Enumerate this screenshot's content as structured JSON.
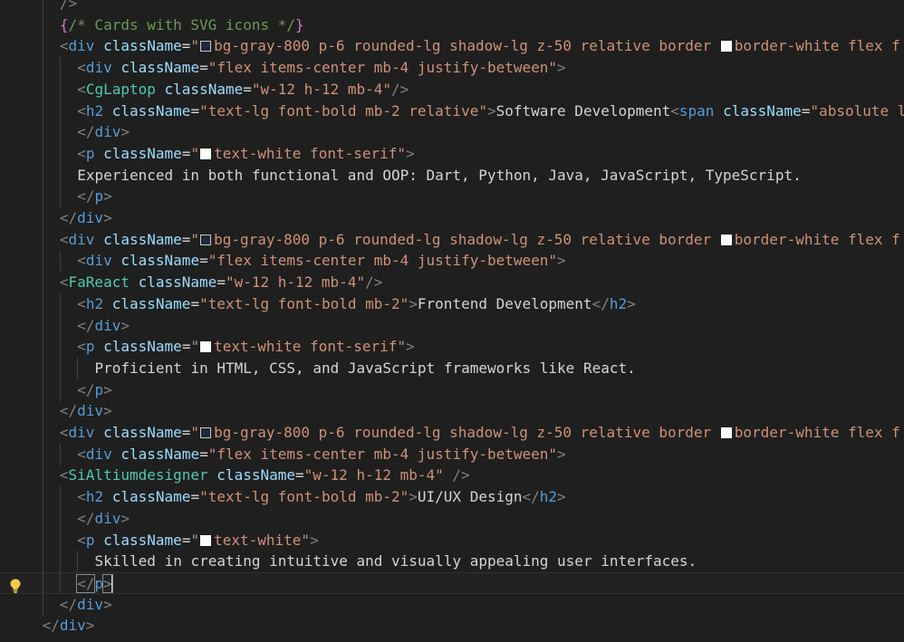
{
  "editor": {
    "colors": {
      "tag_bracket": "#808080",
      "tag_name": "#569cd6",
      "component": "#4ec9b0",
      "attribute": "#9cdcfe",
      "string": "#ce9178",
      "text": "#d4d4d4",
      "brace": "#da70d6",
      "comment": "#6a9955"
    },
    "lightbulb_icon": "lightbulb-icon",
    "lines": [
      {
        "indent": 3,
        "tokens": [
          {
            "c": "tag",
            "v": "/>"
          }
        ]
      },
      {
        "indent": 3,
        "tokens": [
          {
            "c": "brace",
            "v": "{"
          },
          {
            "c": "comment",
            "v": "/* Cards with SVG icons */"
          },
          {
            "c": "brace",
            "v": "}"
          }
        ]
      },
      {
        "indent": 3,
        "tokens": [
          {
            "c": "tag",
            "v": "<"
          },
          {
            "c": "name",
            "v": "div"
          },
          {
            "c": "text",
            "v": " "
          },
          {
            "c": "attr",
            "v": "className"
          },
          {
            "c": "eq",
            "v": "="
          },
          {
            "c": "str",
            "v": "\""
          },
          {
            "c": "swatch",
            "v": "gray"
          },
          {
            "c": "str",
            "v": "bg-gray-800 p-6 rounded-lg shadow-lg z-50 relative border "
          },
          {
            "c": "swatch",
            "v": "white"
          },
          {
            "c": "str",
            "v": "border-white flex f"
          }
        ]
      },
      {
        "indent": 4,
        "tokens": [
          {
            "c": "tag",
            "v": "<"
          },
          {
            "c": "name",
            "v": "div"
          },
          {
            "c": "text",
            "v": " "
          },
          {
            "c": "attr",
            "v": "className"
          },
          {
            "c": "eq",
            "v": "="
          },
          {
            "c": "str",
            "v": "\"flex items-center mb-4 justify-between\""
          },
          {
            "c": "tag",
            "v": ">"
          }
        ]
      },
      {
        "indent": 4,
        "tokens": [
          {
            "c": "tag",
            "v": "<"
          },
          {
            "c": "comp",
            "v": "CgLaptop"
          },
          {
            "c": "text",
            "v": " "
          },
          {
            "c": "attr",
            "v": "className"
          },
          {
            "c": "eq",
            "v": "="
          },
          {
            "c": "str",
            "v": "\"w-12 h-12 mb-4\""
          },
          {
            "c": "tag",
            "v": "/>"
          }
        ]
      },
      {
        "indent": 4,
        "tokens": [
          {
            "c": "tag",
            "v": "<"
          },
          {
            "c": "name",
            "v": "h2"
          },
          {
            "c": "text",
            "v": " "
          },
          {
            "c": "attr",
            "v": "className"
          },
          {
            "c": "eq",
            "v": "="
          },
          {
            "c": "str",
            "v": "\"text-lg font-bold mb-2 relative\""
          },
          {
            "c": "tag",
            "v": ">"
          },
          {
            "c": "text",
            "v": "Software Development"
          },
          {
            "c": "tag",
            "v": "<"
          },
          {
            "c": "name",
            "v": "span"
          },
          {
            "c": "text",
            "v": " "
          },
          {
            "c": "attr",
            "v": "className"
          },
          {
            "c": "eq",
            "v": "="
          },
          {
            "c": "str",
            "v": "\"absolute l"
          }
        ]
      },
      {
        "indent": 4,
        "tokens": [
          {
            "c": "tag",
            "v": "</"
          },
          {
            "c": "name",
            "v": "div"
          },
          {
            "c": "tag",
            "v": ">"
          }
        ]
      },
      {
        "indent": 4,
        "tokens": [
          {
            "c": "tag",
            "v": "<"
          },
          {
            "c": "name",
            "v": "p"
          },
          {
            "c": "text",
            "v": " "
          },
          {
            "c": "attr",
            "v": "className"
          },
          {
            "c": "eq",
            "v": "="
          },
          {
            "c": "str",
            "v": "\""
          },
          {
            "c": "swatch",
            "v": "white"
          },
          {
            "c": "str",
            "v": "text-white font-serif\""
          },
          {
            "c": "tag",
            "v": ">"
          }
        ]
      },
      {
        "indent": 4,
        "tokens": [
          {
            "c": "text",
            "v": "Experienced in both functional and OOP: Dart, Python, Java, JavaScript, TypeScript."
          }
        ]
      },
      {
        "indent": 4,
        "tokens": [
          {
            "c": "tag",
            "v": "</"
          },
          {
            "c": "name",
            "v": "p"
          },
          {
            "c": "tag",
            "v": ">"
          }
        ]
      },
      {
        "indent": 3,
        "tokens": [
          {
            "c": "tag",
            "v": "</"
          },
          {
            "c": "name",
            "v": "div"
          },
          {
            "c": "tag",
            "v": ">"
          }
        ]
      },
      {
        "indent": 3,
        "tokens": [
          {
            "c": "tag",
            "v": "<"
          },
          {
            "c": "name",
            "v": "div"
          },
          {
            "c": "text",
            "v": " "
          },
          {
            "c": "attr",
            "v": "className"
          },
          {
            "c": "eq",
            "v": "="
          },
          {
            "c": "str",
            "v": "\""
          },
          {
            "c": "swatch",
            "v": "gray"
          },
          {
            "c": "str",
            "v": "bg-gray-800 p-6 rounded-lg shadow-lg z-50 relative border "
          },
          {
            "c": "swatch",
            "v": "white"
          },
          {
            "c": "str",
            "v": "border-white flex f"
          }
        ]
      },
      {
        "indent": 4,
        "tokens": [
          {
            "c": "tag",
            "v": "<"
          },
          {
            "c": "name",
            "v": "div"
          },
          {
            "c": "text",
            "v": " "
          },
          {
            "c": "attr",
            "v": "className"
          },
          {
            "c": "eq",
            "v": "="
          },
          {
            "c": "str",
            "v": "\"flex items-center mb-4 justify-between\""
          },
          {
            "c": "tag",
            "v": ">"
          }
        ]
      },
      {
        "indent": 3,
        "tokens": [
          {
            "c": "tag",
            "v": "<"
          },
          {
            "c": "comp",
            "v": "FaReact"
          },
          {
            "c": "text",
            "v": " "
          },
          {
            "c": "attr",
            "v": "className"
          },
          {
            "c": "eq",
            "v": "="
          },
          {
            "c": "str",
            "v": "\"w-12 h-12 mb-4\""
          },
          {
            "c": "tag",
            "v": "/>"
          }
        ]
      },
      {
        "indent": 4,
        "tokens": [
          {
            "c": "tag",
            "v": "<"
          },
          {
            "c": "name",
            "v": "h2"
          },
          {
            "c": "text",
            "v": " "
          },
          {
            "c": "attr",
            "v": "className"
          },
          {
            "c": "eq",
            "v": "="
          },
          {
            "c": "str",
            "v": "\"text-lg font-bold mb-2\""
          },
          {
            "c": "tag",
            "v": ">"
          },
          {
            "c": "text",
            "v": "Frontend Development"
          },
          {
            "c": "tag",
            "v": "</"
          },
          {
            "c": "name",
            "v": "h2"
          },
          {
            "c": "tag",
            "v": ">"
          }
        ]
      },
      {
        "indent": 4,
        "tokens": [
          {
            "c": "tag",
            "v": "</"
          },
          {
            "c": "name",
            "v": "div"
          },
          {
            "c": "tag",
            "v": ">"
          }
        ]
      },
      {
        "indent": 4,
        "tokens": [
          {
            "c": "tag",
            "v": "<"
          },
          {
            "c": "name",
            "v": "p"
          },
          {
            "c": "text",
            "v": " "
          },
          {
            "c": "attr",
            "v": "className"
          },
          {
            "c": "eq",
            "v": "="
          },
          {
            "c": "str",
            "v": "\""
          },
          {
            "c": "swatch",
            "v": "white"
          },
          {
            "c": "str",
            "v": "text-white font-serif\""
          },
          {
            "c": "tag",
            "v": ">"
          }
        ]
      },
      {
        "indent": 5,
        "tokens": [
          {
            "c": "text",
            "v": "Proficient in HTML, CSS, and JavaScript frameworks like React."
          }
        ]
      },
      {
        "indent": 4,
        "tokens": [
          {
            "c": "tag",
            "v": "</"
          },
          {
            "c": "name",
            "v": "p"
          },
          {
            "c": "tag",
            "v": ">"
          }
        ]
      },
      {
        "indent": 3,
        "tokens": [
          {
            "c": "tag",
            "v": "</"
          },
          {
            "c": "name",
            "v": "div"
          },
          {
            "c": "tag",
            "v": ">"
          }
        ]
      },
      {
        "indent": 3,
        "tokens": [
          {
            "c": "tag",
            "v": "<"
          },
          {
            "c": "name",
            "v": "div"
          },
          {
            "c": "text",
            "v": " "
          },
          {
            "c": "attr",
            "v": "className"
          },
          {
            "c": "eq",
            "v": "="
          },
          {
            "c": "str",
            "v": "\""
          },
          {
            "c": "swatch",
            "v": "gray"
          },
          {
            "c": "str",
            "v": "bg-gray-800 p-6 rounded-lg shadow-lg z-50 relative border "
          },
          {
            "c": "swatch",
            "v": "white"
          },
          {
            "c": "str",
            "v": "border-white flex f"
          }
        ]
      },
      {
        "indent": 4,
        "tokens": [
          {
            "c": "tag",
            "v": "<"
          },
          {
            "c": "name",
            "v": "div"
          },
          {
            "c": "text",
            "v": " "
          },
          {
            "c": "attr",
            "v": "className"
          },
          {
            "c": "eq",
            "v": "="
          },
          {
            "c": "str",
            "v": "\"flex items-center mb-4 justify-between\""
          },
          {
            "c": "tag",
            "v": ">"
          }
        ]
      },
      {
        "indent": 3,
        "tokens": [
          {
            "c": "tag",
            "v": "<"
          },
          {
            "c": "comp",
            "v": "SiAltiumdesigner"
          },
          {
            "c": "text",
            "v": " "
          },
          {
            "c": "attr",
            "v": "className"
          },
          {
            "c": "eq",
            "v": "="
          },
          {
            "c": "str",
            "v": "\"w-12 h-12 mb-4\""
          },
          {
            "c": "text",
            "v": " "
          },
          {
            "c": "tag",
            "v": "/>"
          }
        ]
      },
      {
        "indent": 4,
        "tokens": [
          {
            "c": "tag",
            "v": "<"
          },
          {
            "c": "name",
            "v": "h2"
          },
          {
            "c": "text",
            "v": " "
          },
          {
            "c": "attr",
            "v": "className"
          },
          {
            "c": "eq",
            "v": "="
          },
          {
            "c": "str",
            "v": "\"text-lg font-bold mb-2\""
          },
          {
            "c": "tag",
            "v": ">"
          },
          {
            "c": "text",
            "v": "UI/UX Design"
          },
          {
            "c": "tag",
            "v": "</"
          },
          {
            "c": "name",
            "v": "h2"
          },
          {
            "c": "tag",
            "v": ">"
          }
        ]
      },
      {
        "indent": 4,
        "tokens": [
          {
            "c": "tag",
            "v": "</"
          },
          {
            "c": "name",
            "v": "div"
          },
          {
            "c": "tag",
            "v": ">"
          }
        ]
      },
      {
        "indent": 4,
        "tokens": [
          {
            "c": "tag",
            "v": "<"
          },
          {
            "c": "name",
            "v": "p"
          },
          {
            "c": "text",
            "v": " "
          },
          {
            "c": "attr",
            "v": "className"
          },
          {
            "c": "eq",
            "v": "="
          },
          {
            "c": "str",
            "v": "\""
          },
          {
            "c": "swatch",
            "v": "white"
          },
          {
            "c": "str",
            "v": "text-white\""
          },
          {
            "c": "tag",
            "v": ">"
          }
        ]
      },
      {
        "indent": 5,
        "tokens": [
          {
            "c": "text",
            "v": "Skilled in creating intuitive and visually appealing user interfaces."
          }
        ]
      },
      {
        "indent": 4,
        "current": true,
        "tokens": [
          {
            "c": "tagbox",
            "v": "</"
          },
          {
            "c": "name",
            "v": "p"
          },
          {
            "c": "tagbox",
            "v": ">"
          },
          {
            "c": "cursor",
            "v": "cursor"
          }
        ]
      },
      {
        "indent": 3,
        "tokens": [
          {
            "c": "tag",
            "v": "</"
          },
          {
            "c": "name",
            "v": "div"
          },
          {
            "c": "tag",
            "v": ">"
          }
        ]
      },
      {
        "indent": 2,
        "tokens": [
          {
            "c": "tag",
            "v": "</"
          },
          {
            "c": "name",
            "v": "div"
          },
          {
            "c": "tag",
            "v": ">"
          }
        ]
      }
    ]
  }
}
